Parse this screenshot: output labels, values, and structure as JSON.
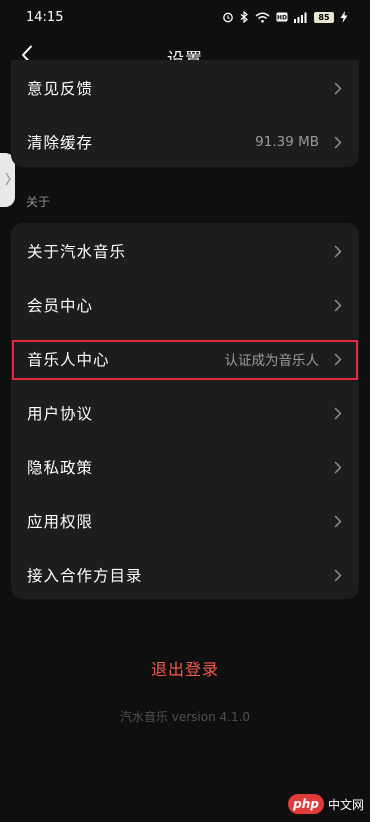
{
  "status_bar": {
    "time": "14:15",
    "battery_level": "85"
  },
  "header": {
    "title": "设置"
  },
  "top_card": {
    "items": [
      {
        "label": "意见反馈",
        "value": ""
      },
      {
        "label": "清除缓存",
        "value": "91.39 MB"
      }
    ]
  },
  "about_section": {
    "label": "关于",
    "items": [
      {
        "label": "关于汽水音乐",
        "value": ""
      },
      {
        "label": "会员中心",
        "value": ""
      },
      {
        "label": "音乐人中心",
        "value": "认证成为音乐人"
      },
      {
        "label": "用户协议",
        "value": ""
      },
      {
        "label": "隐私政策",
        "value": ""
      },
      {
        "label": "应用权限",
        "value": ""
      },
      {
        "label": "接入合作方目录",
        "value": ""
      }
    ]
  },
  "logout_label": "退出登录",
  "version_text": "汽水音乐 version 4.1.0",
  "watermark": {
    "logo_text": "php",
    "site_text": "中文网"
  },
  "colors": {
    "background": "#0f0f10",
    "card": "#1d1d1f",
    "accent_red": "#f25b4c",
    "highlight_border": "#e8283d"
  }
}
